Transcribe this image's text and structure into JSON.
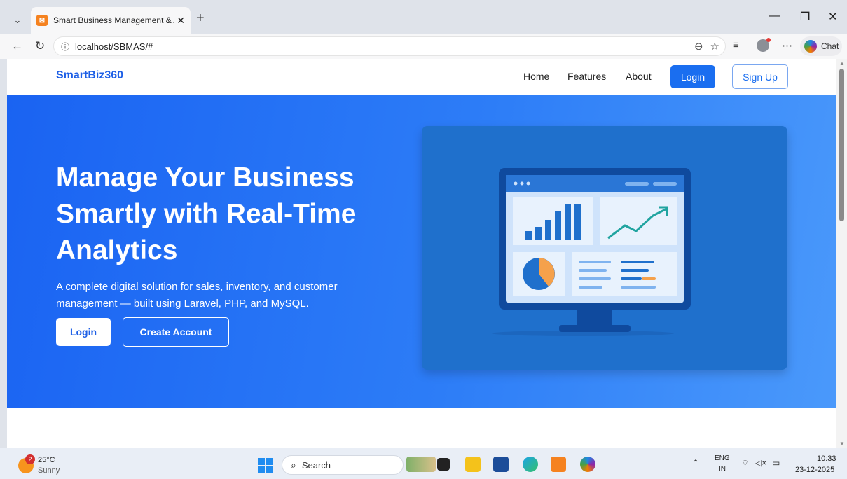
{
  "browser": {
    "tab_title": "Smart Business Management & An",
    "favicon_text": "⊠",
    "url": "localhost/SBMAS/#",
    "chat_label": "Chat"
  },
  "site": {
    "brand": "SmartBiz360",
    "nav": {
      "home": "Home",
      "features": "Features",
      "about": "About",
      "login": "Login",
      "signup": "Sign Up"
    },
    "hero": {
      "title": "Manage Your Business Smartly with Real-Time Analytics",
      "subtitle": "A complete digital solution for sales, inventory, and customer management — built using Laravel, PHP, and MySQL.",
      "login_button": "Login",
      "create_button": "Create Account"
    },
    "colors": {
      "brand": "#1d5fe6",
      "hero_gradient_start": "#1a63f2",
      "hero_gradient_end": "#4a99fb",
      "illustration_bg": "#1f70cc"
    }
  },
  "taskbar": {
    "weather": {
      "badge": "2",
      "temp": "25°C",
      "condition": "Sunny"
    },
    "search_label": "Search",
    "language": {
      "line1": "ENG",
      "line2": "IN"
    },
    "clock": {
      "time": "10:33",
      "date": "23-12-2025"
    }
  }
}
